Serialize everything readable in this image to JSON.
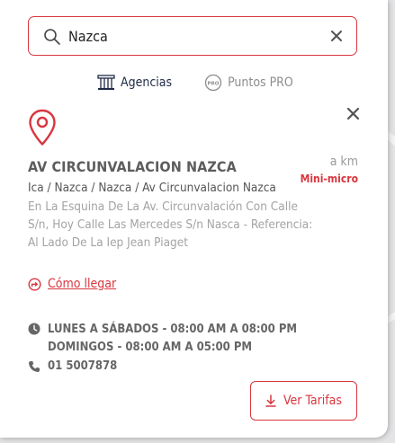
{
  "search": {
    "value": "Nazca",
    "placeholder": ""
  },
  "tabs": [
    {
      "label": "Agencias",
      "icon": "building-icon",
      "active": true
    },
    {
      "label": "Puntos PRO",
      "icon": "pro-badge-icon",
      "active": false
    }
  ],
  "agency": {
    "name": "AV CIRCUNVALACION NAZCA",
    "distance": "a km",
    "category": "Mini-micro",
    "path": "Ica / Nazca / Nazca / Av Circunvalacion Nazca",
    "reference": "En La Esquina De La Av. Circunvalación Con Calle S/n, Hoy Calle Las Mercedes S/n Nasca - Referencia: Al Lado De La Iep Jean Piaget",
    "route_label": "Cómo llegar",
    "hours": [
      "LUNES A SÁBADOS - 08:00 AM A 08:00 PM",
      "DOMINGOS - 08:00 AM A 05:00 PM"
    ],
    "phone": "01 5007878"
  },
  "button": {
    "label": "Ver Tarifas"
  },
  "colors": {
    "accent": "#d9363e",
    "navy": "#1f2b46",
    "muted": "#a3a3a3"
  }
}
